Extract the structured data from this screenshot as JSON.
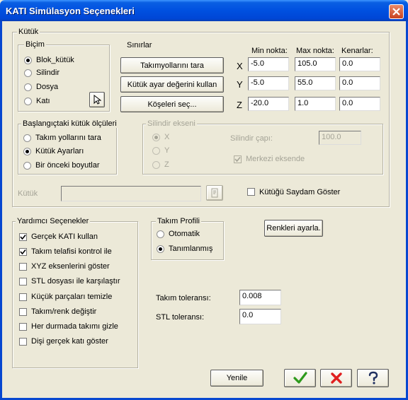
{
  "window": {
    "title": "KATI Simülasyon Seçenekleri"
  },
  "kutuk": {
    "legend": "Kütük",
    "bicim": {
      "legend": "Biçim",
      "options": [
        {
          "label": "Blok_kütük",
          "selected": true
        },
        {
          "label": "Silindir",
          "selected": false
        },
        {
          "label": "Dosya",
          "selected": false
        },
        {
          "label": "Katı",
          "selected": false
        }
      ],
      "pick_icon": "pointer-arrow-icon"
    },
    "sinirlar": {
      "label": "Sınırlar",
      "buttons": [
        "Takımyollarını tara",
        "Kütük ayar değerini kullan",
        "Köşeleri seç..."
      ],
      "col_min": "Min nokta:",
      "col_max": "Max nokta:",
      "col_kenar": "Kenarlar:",
      "rows": [
        {
          "axis": "X",
          "min": "-5.0",
          "max": "105.0",
          "edge": "0.0"
        },
        {
          "axis": "Y",
          "min": "-5.0",
          "max": "55.0",
          "edge": "0.0"
        },
        {
          "axis": "Z",
          "min": "-20.0",
          "max": "1.0",
          "edge": "0.0"
        }
      ]
    },
    "baslangic": {
      "legend": "Başlangıçtaki kütük ölçüleri",
      "options": [
        {
          "label": "Takım yollarını tara",
          "selected": false
        },
        {
          "label": "Kütük Ayarları",
          "selected": true
        },
        {
          "label": "Bir önceki boyutlar",
          "selected": false
        }
      ]
    },
    "silindir_ekseni": {
      "legend": "Silindir ekseni",
      "options": [
        {
          "label": "X",
          "selected": true
        },
        {
          "label": "Y",
          "selected": false
        },
        {
          "label": "Z",
          "selected": false
        }
      ],
      "diameter_label": "Silindir çapı:",
      "diameter_value": "100.0",
      "center_label": "Merkezi eksende",
      "center_checked": true
    },
    "file_label": "Kütük",
    "file_value": "",
    "transparent_label": "Kütüğü Saydam Göster",
    "transparent_checked": false
  },
  "yardimci": {
    "legend": "Yardımcı Seçenekler",
    "items": [
      {
        "label": "Gerçek KATI kullan",
        "checked": true
      },
      {
        "label": "Takım telafisi kontrol ile",
        "checked": true
      },
      {
        "label": "XYZ eksenlerini göster",
        "checked": false
      },
      {
        "label": "STL dosyası ile karşılaştır",
        "checked": false
      },
      {
        "label": "Küçük parçaları temizle",
        "checked": false
      },
      {
        "label": "Takım/renk değiştir",
        "checked": false
      },
      {
        "label": "Her durmada takımı gizle",
        "checked": false
      },
      {
        "label": "Dişi gerçek katı göster",
        "checked": false
      }
    ]
  },
  "takim_profili": {
    "legend": "Takım Profili",
    "options": [
      {
        "label": "Otomatik",
        "selected": false
      },
      {
        "label": "Tanımlanmış",
        "selected": true
      }
    ]
  },
  "colors_button": "Renkleri ayarla.",
  "tolerances": {
    "tool_label": "Takım toleransı:",
    "tool_value": "0.008",
    "stl_label": "STL toleransı:",
    "stl_value": "0.0"
  },
  "footer": {
    "refresh": "Yenile",
    "ok_icon": "checkmark-icon",
    "cancel_icon": "red-x-icon",
    "help_icon": "question-mark-icon"
  }
}
